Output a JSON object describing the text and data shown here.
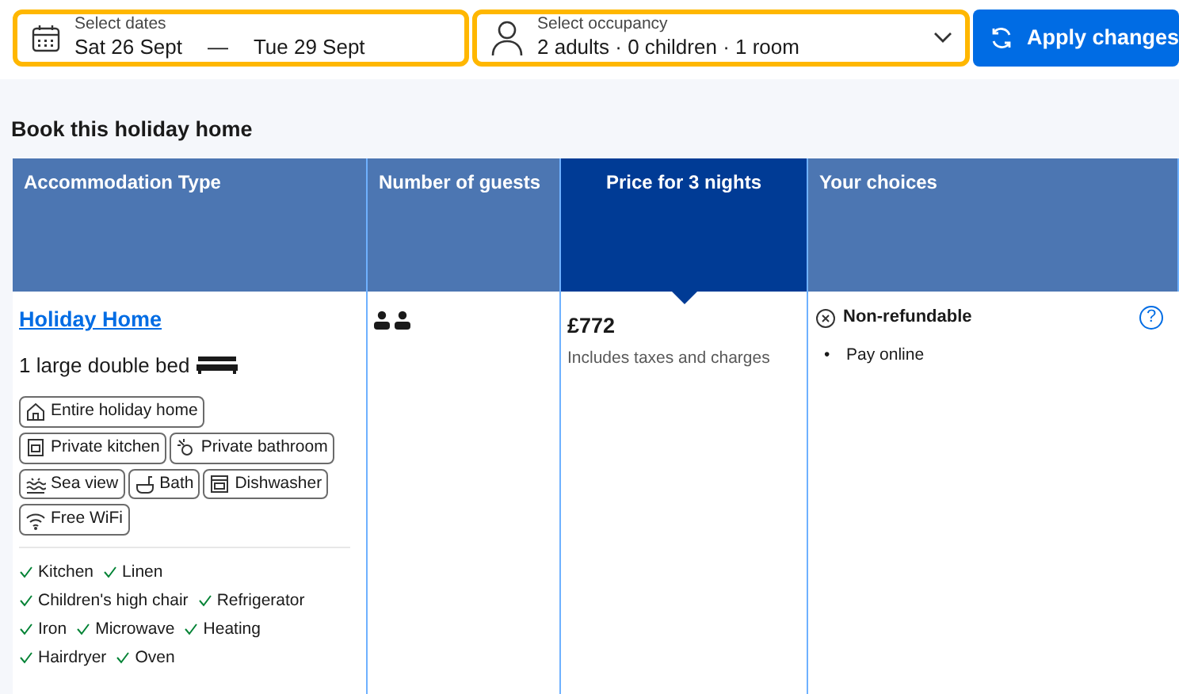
{
  "search_bar": {
    "dates": {
      "label": "Select dates",
      "check_in": "Sat 26 Sept",
      "separator": "—",
      "check_out": "Tue 29 Sept"
    },
    "occupancy": {
      "label": "Select occupancy",
      "value": "2 adults · 0 children · 1 room"
    },
    "apply_button": "Apply changes"
  },
  "section_title": "Book this holiday home",
  "table": {
    "columns": [
      {
        "label": "Accommodation Type",
        "selected": false
      },
      {
        "label": "Number of guests",
        "selected": false
      },
      {
        "label": "Price for 3 nights",
        "selected": true
      },
      {
        "label": "Your choices",
        "selected": false
      }
    ],
    "row": {
      "name": "Holiday Home",
      "bed": "1 large double bed",
      "facilities": [
        {
          "kind": "house",
          "label": "Entire holiday home"
        },
        {
          "kind": "kitchen",
          "label": "Private kitchen"
        },
        {
          "kind": "bathroom",
          "label": "Private bathroom"
        },
        {
          "kind": "sea",
          "label": "Sea view"
        },
        {
          "kind": "bath",
          "label": "Bath"
        },
        {
          "kind": "dishwasher",
          "label": "Dishwasher"
        },
        {
          "kind": "wifi",
          "label": "Free WiFi"
        }
      ],
      "amenity_lines": [
        [
          "Kitchen",
          "Linen"
        ],
        [
          "Children's high chair",
          "Refrigerator"
        ],
        [
          "Iron",
          "Microwave",
          "Heating"
        ],
        [
          "Hairdryer",
          "Oven"
        ]
      ],
      "price": "£772",
      "price_note": "Includes taxes and charges",
      "choice": "Non-refundable",
      "help": "?",
      "choice_details": [
        {
          "bullet": "•",
          "text": "Pay online"
        }
      ]
    }
  }
}
